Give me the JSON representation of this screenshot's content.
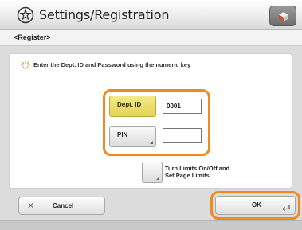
{
  "header": {
    "title": "Settings/Registration",
    "icon": "settings-gear-icon",
    "right_button_icon": "status-monitor-icon"
  },
  "subheader": {
    "label": "<Register>"
  },
  "instruction": {
    "icon": "info-sparkle-icon",
    "text": "Enter the Dept. ID and Password using the numeric key"
  },
  "form": {
    "dept_id_label": "Dept. ID",
    "dept_id_value": "0001",
    "pin_label": "PIN",
    "pin_value": ""
  },
  "limits": {
    "line1": "Turn Limits On/Off and",
    "line2": "Set Page Limits"
  },
  "buttons": {
    "cancel_label": "Cancel",
    "ok_label": "OK"
  },
  "colors": {
    "highlight": "#f08a1c",
    "dept_id_active": "#e8db60"
  }
}
